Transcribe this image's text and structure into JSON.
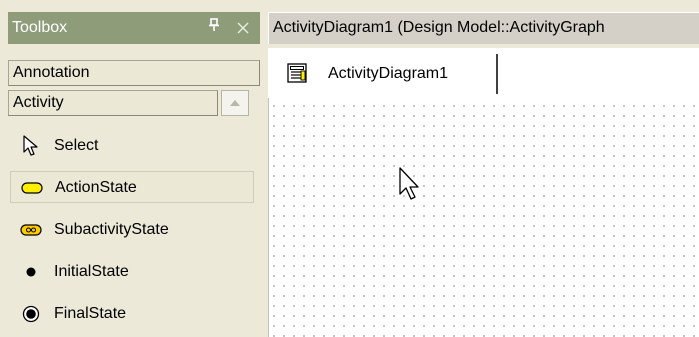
{
  "toolbox": {
    "title": "Toolbox",
    "pin_icon": "pin-icon",
    "close_icon": "close-icon",
    "categories": [
      {
        "label": "Annotation"
      },
      {
        "label": "Activity"
      }
    ],
    "items": [
      {
        "label": "Select",
        "icon": "pointer-arrow-icon"
      },
      {
        "label": "ActionState",
        "icon": "action-state-icon",
        "selected": true
      },
      {
        "label": "SubactivityState",
        "icon": "subactivity-state-icon"
      },
      {
        "label": "InitialState",
        "icon": "initial-state-icon"
      },
      {
        "label": "FinalState",
        "icon": "final-state-icon"
      }
    ],
    "title_bg": "#8f9c7a",
    "action_state_color": "#ffee00"
  },
  "document": {
    "title": "ActivityDiagram1 (Design Model::ActivityGraph",
    "tab": {
      "label": "ActivityDiagram1",
      "icon": "diagram-document-icon"
    }
  }
}
